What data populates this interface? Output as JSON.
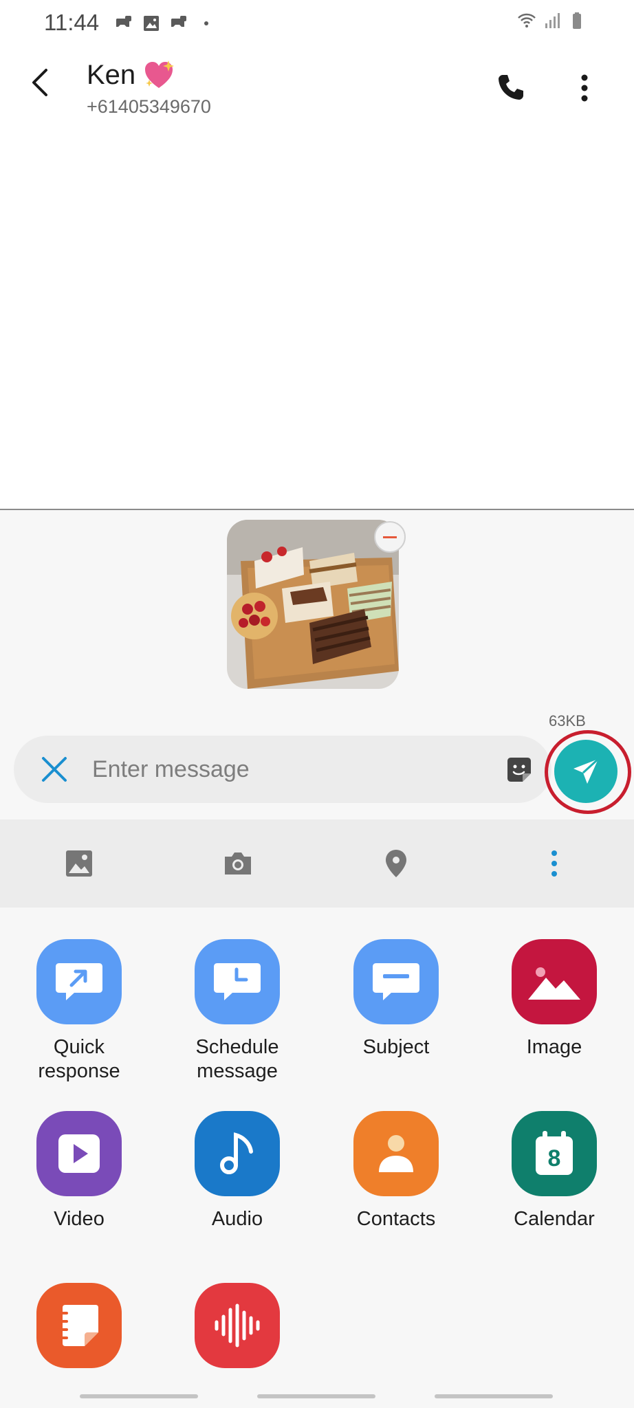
{
  "status_bar": {
    "time": "11:44"
  },
  "header": {
    "contact_name": "Ken",
    "phone_number": "+61405349670"
  },
  "attachment": {
    "size": "63KB"
  },
  "composer": {
    "placeholder": "Enter message"
  },
  "options": [
    {
      "label": "Quick response",
      "icon": "quick-response-icon",
      "color": "#5b9cf5"
    },
    {
      "label": "Schedule message",
      "icon": "schedule-message-icon",
      "color": "#5b9cf5"
    },
    {
      "label": "Subject",
      "icon": "subject-icon",
      "color": "#5b9cf5"
    },
    {
      "label": "Image",
      "icon": "image-icon",
      "color": "#c4163f"
    },
    {
      "label": "Video",
      "icon": "video-icon",
      "color": "#7a4bb8"
    },
    {
      "label": "Audio",
      "icon": "audio-icon",
      "color": "#1a79c9"
    },
    {
      "label": "Contacts",
      "icon": "contacts-icon",
      "color": "#ef7f2a"
    },
    {
      "label": "Calendar",
      "icon": "calendar-icon",
      "color": "#0f7f6c"
    },
    {
      "label": "",
      "icon": "memo-icon",
      "color": "#ea5a2b"
    },
    {
      "label": "",
      "icon": "voice-recorder-icon",
      "color": "#e3393f"
    }
  ],
  "calendar_day": "8",
  "colors": {
    "send_button": "#1cb2b3",
    "highlight_ring": "#c81e2e",
    "accent": "#1a8fd0"
  }
}
